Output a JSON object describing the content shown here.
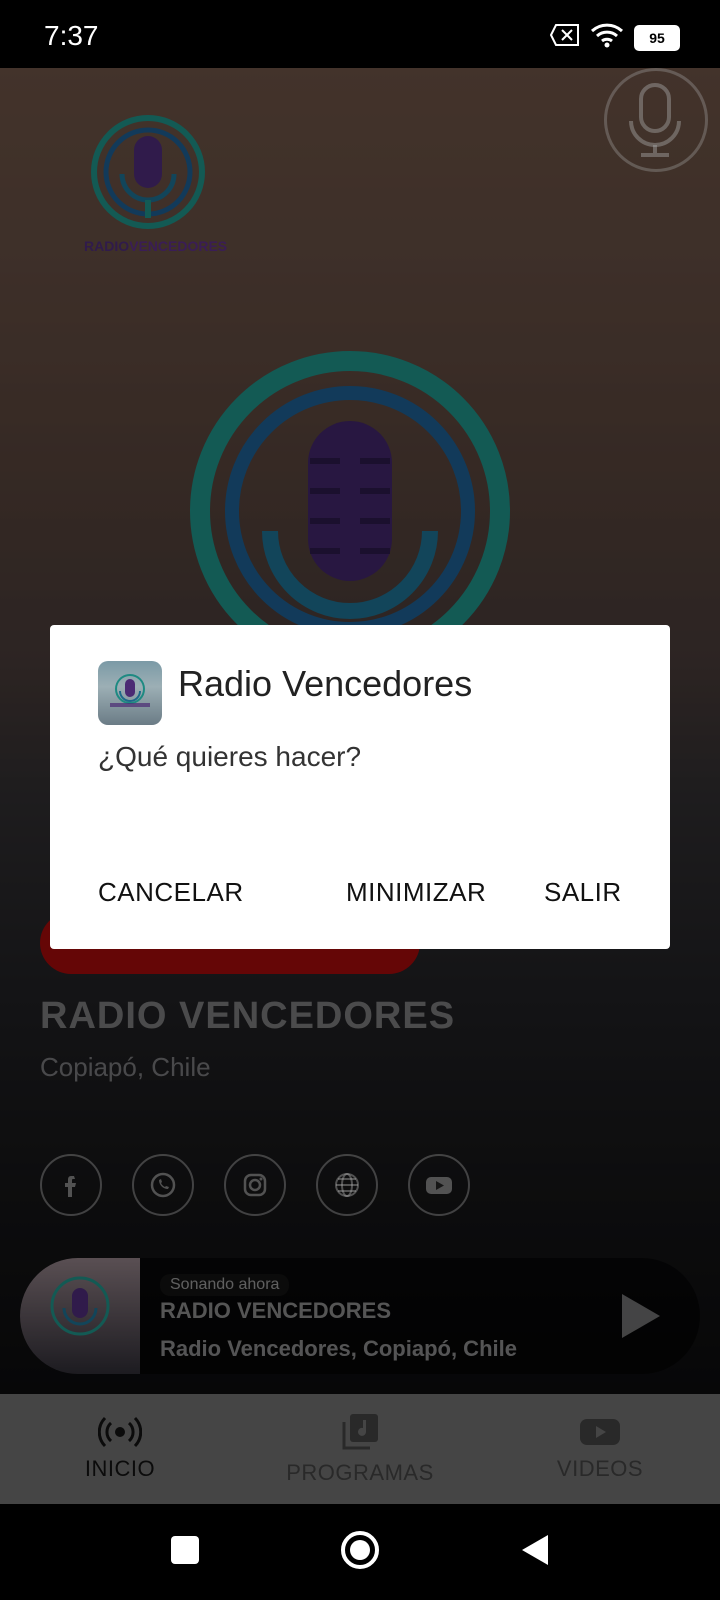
{
  "status": {
    "time": "7:37",
    "battery": "95"
  },
  "app": {
    "station_name": "RADIO VENCEDORES",
    "location": "Copiapó, Chile",
    "now_playing": {
      "chip": "Sonando ahora",
      "title": "RADIO VENCEDORES",
      "subtitle": "Radio Vencedores, Copiapó, Chile"
    },
    "logo_text": {
      "part1": "RADIO",
      "part2": "VENCEDORES"
    }
  },
  "dialog": {
    "title": "Radio Vencedores",
    "message": "¿Qué quieres hacer?",
    "buttons": {
      "cancel": "CANCELAR",
      "minimize": "MINIMIZAR",
      "exit": "SALIR"
    }
  },
  "bottom_nav": [
    {
      "label": "INICIO",
      "icon": "radio-icon",
      "active": true
    },
    {
      "label": "PROGRAMAS",
      "icon": "music-library-icon",
      "active": false
    },
    {
      "label": "VIDEOS",
      "icon": "youtube-icon",
      "active": false
    }
  ],
  "social": [
    "facebook-icon",
    "whatsapp-icon",
    "instagram-icon",
    "globe-icon",
    "youtube-icon"
  ],
  "colors": {
    "accent_red": "#9b0a0a",
    "dialog_bg": "#ffffff",
    "nav_bg": "#6b6b6b"
  }
}
